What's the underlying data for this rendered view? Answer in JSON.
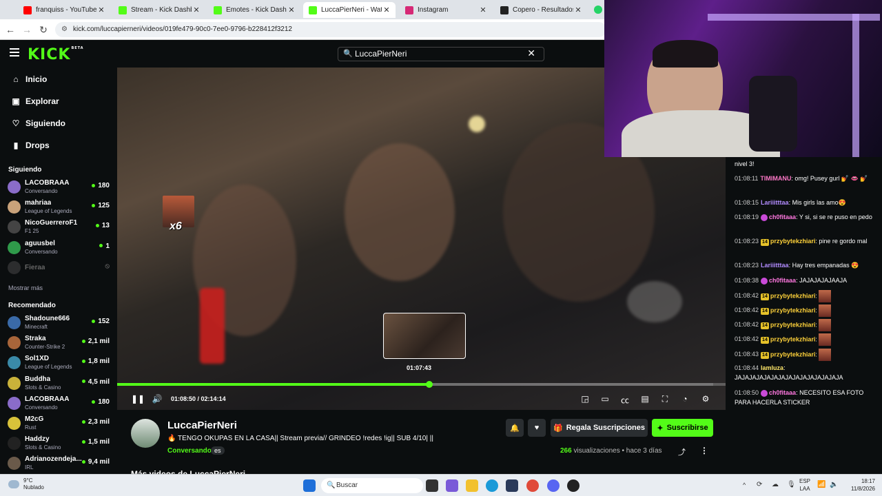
{
  "browser": {
    "tabs": [
      {
        "title": "franquiss - YouTube",
        "color": "#ff0000",
        "active": false
      },
      {
        "title": "Stream - Kick Dashboard",
        "color": "#53fc18",
        "active": false
      },
      {
        "title": "Emotes - Kick Dashboard",
        "color": "#53fc18",
        "active": false
      },
      {
        "title": "LuccaPierNeri - Watch",
        "color": "#53fc18",
        "active": true
      },
      {
        "title": "Instagram",
        "color": "#d62976",
        "active": false
      },
      {
        "title": "Copero - Resultados, esta",
        "color": "#222222",
        "active": false
      }
    ],
    "url": "kick.com/luccapierneri/videos/019fe479-90c0-7ee0-9796-b228412f3212"
  },
  "header": {
    "logo": "KICK",
    "logo_badge": "BETA",
    "search_value": "LuccaPierNeri"
  },
  "sidebar": {
    "nav": [
      {
        "label": "Inicio",
        "icon": "home-icon"
      },
      {
        "label": "Explorar",
        "icon": "explore-icon"
      },
      {
        "label": "Siguiendo",
        "icon": "heart-icon"
      },
      {
        "label": "Drops",
        "icon": "drops-icon"
      }
    ],
    "following_title": "Siguiendo",
    "following": [
      {
        "name": "LACOBRAAA",
        "category": "Conversando",
        "viewers": "180",
        "color": "#8a6cc9"
      },
      {
        "name": "mahriaa",
        "category": "League of Legends",
        "viewers": "125",
        "color": "#c9a27a"
      },
      {
        "name": "NicoGuerreroF1",
        "category": "F1 25",
        "viewers": "13",
        "color": "#444444"
      },
      {
        "name": "aguusbel",
        "category": "Conversando",
        "viewers": "1",
        "color": "#2f9a4a"
      },
      {
        "name": "Fieraa",
        "category": "",
        "viewers": "",
        "color": "#555555",
        "offline": true
      }
    ],
    "show_more": "Mostrar más",
    "recommended_title": "Recomendado",
    "recommended": [
      {
        "name": "Shadoune666",
        "category": "Minecraft",
        "viewers": "152",
        "color": "#3a6aa8"
      },
      {
        "name": "Straka",
        "category": "Counter-Strike 2",
        "viewers": "2,1 mil",
        "color": "#a8653a"
      },
      {
        "name": "Sol1XD",
        "category": "League of Legends",
        "viewers": "1,8 mil",
        "color": "#3a8aa8"
      },
      {
        "name": "Buddha",
        "category": "Slots & Casino",
        "viewers": "4,5 mil",
        "color": "#c9b23a"
      },
      {
        "name": "LACOBRAAA",
        "category": "Conversando",
        "viewers": "180",
        "color": "#8a6cc9"
      },
      {
        "name": "M2cG",
        "category": "Rust",
        "viewers": "2,3 mil",
        "color": "#d8c23a"
      },
      {
        "name": "Haddzy",
        "category": "Slots & Casino",
        "viewers": "1,5 mil",
        "color": "#222222"
      },
      {
        "name": "Adrianozendeja...",
        "category": "IRL",
        "viewers": "9,4 mil",
        "color": "#6a5a4a"
      }
    ]
  },
  "player": {
    "emote_count": "x6",
    "preview_time": "01:07:43",
    "current_time": "01:08:50",
    "duration": "02:14:14",
    "progress_fraction": 0.5128,
    "buffered_fraction": 0.98
  },
  "chat": {
    "messages": [
      {
        "time": "",
        "user": "",
        "user_color": "#ffffff",
        "text": "nivel 3!",
        "badge": ""
      },
      {
        "time": "01:08:11",
        "user": "TIMIMANU",
        "user_color": "#ff78c8",
        "text": "omg! Pusey gurl 💅 👄 💅",
        "badge": ""
      },
      {
        "time": "01:08:15",
        "user": "Lariiitttaa",
        "user_color": "#b28cff",
        "text": "Mis girls las amo😍",
        "badge": ""
      },
      {
        "time": "01:08:19",
        "user": "ch0fitaaa",
        "user_color": "#ff78e0",
        "text": "Y si, si se re puso en pedo",
        "badge": "sub"
      },
      {
        "time": "01:08:23",
        "user": "przybytekzhiari",
        "user_color": "#ffd23a",
        "text": "pine re gordo mal",
        "badge": "14"
      },
      {
        "time": "01:08:23",
        "user": "Lariiitttaa",
        "user_color": "#b28cff",
        "text": "Hay tres empanadas 😍",
        "badge": ""
      },
      {
        "time": "01:08:38",
        "user": "ch0fitaaa",
        "user_color": "#ff78e0",
        "text": "JAJAJAJAJAAJA",
        "badge": "sub"
      },
      {
        "time": "01:08:42",
        "user": "przybytekzhiari",
        "user_color": "#ffd23a",
        "text": "",
        "badge": "14",
        "emote": true
      },
      {
        "time": "01:08:42",
        "user": "przybytekzhiari",
        "user_color": "#ffd23a",
        "text": "",
        "badge": "14",
        "emote": true
      },
      {
        "time": "01:08:42",
        "user": "przybytekzhiari",
        "user_color": "#ffd23a",
        "text": "",
        "badge": "14",
        "emote": true
      },
      {
        "time": "01:08:42",
        "user": "przybytekzhiari",
        "user_color": "#ffd23a",
        "text": "",
        "badge": "14",
        "emote": true
      },
      {
        "time": "01:08:43",
        "user": "przybytekzhiari",
        "user_color": "#ffd23a",
        "text": "",
        "badge": "14",
        "emote": true
      },
      {
        "time": "01:08:44",
        "user": "lamluza",
        "user_color": "#ffe86a",
        "text": "JAJAJAJAJAJAJAJAJAJAJAJAJAJAJA",
        "badge": ""
      },
      {
        "time": "01:08:50",
        "user": "ch0fitaaa",
        "user_color": "#ff78e0",
        "text": "NECESITO ESA FOTO PARA HACERLA STICKER",
        "badge": "sub"
      }
    ]
  },
  "channel": {
    "name": "LuccaPierNeri",
    "title": "🔥 TENGO OKUPAS EN LA CASA|| Stream previa// GRINDEO !redes !ig|| SUB 4/10| ||",
    "category": "Conversando",
    "language": "es",
    "gift_label": "Regala Suscripciones",
    "subscribe_label": "Suscribirse",
    "views_count": "266",
    "views_label": "visualizaciones",
    "age": "hace 3 días",
    "more_videos": "Más videos de LuccaPierNeri"
  },
  "taskbar": {
    "weather_temp": "9°C",
    "weather_desc": "Nublado",
    "search_placeholder": "Buscar",
    "lang_top": "ESP",
    "lang_bottom": "LAA",
    "time": "18:17",
    "date": "11/8/2026"
  }
}
